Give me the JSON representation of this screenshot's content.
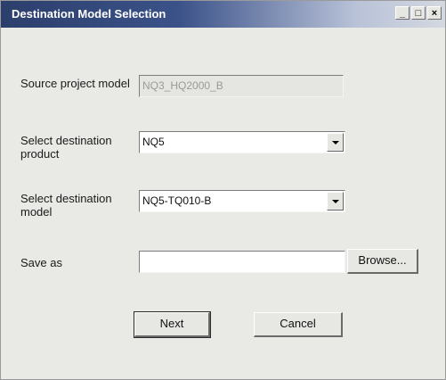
{
  "window": {
    "title": "Destination Model Selection",
    "minimize_label": "_",
    "maximize_label": "□",
    "close_label": "×"
  },
  "form": {
    "source_label": "Source project model",
    "source_value": "NQ3_HQ2000_B",
    "product_label": "Select destination product",
    "product_value": "NQ5",
    "model_label": "Select destination model",
    "model_value": "NQ5-TQ010-B",
    "saveas_label": "Save as",
    "saveas_value": "",
    "browse_label": "Browse..."
  },
  "actions": {
    "next_label": "Next",
    "cancel_label": "Cancel"
  }
}
